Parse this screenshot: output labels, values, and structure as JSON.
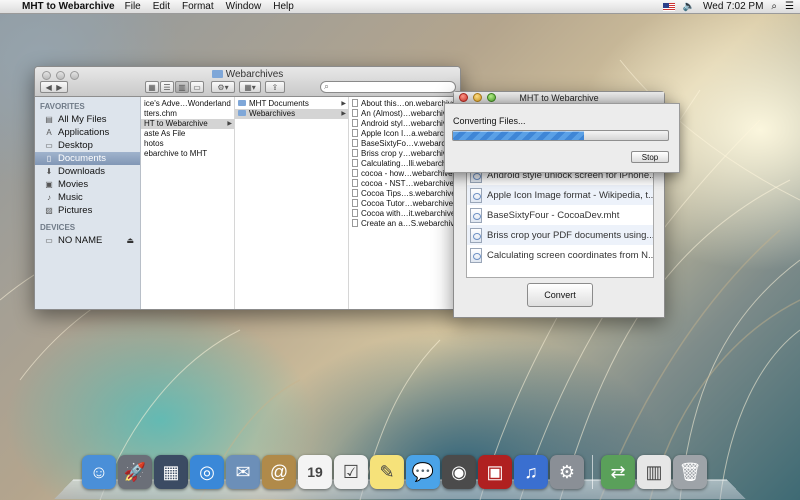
{
  "menubar": {
    "app_name": "MHT to Webarchive",
    "menus": [
      "File",
      "Edit",
      "Format",
      "Window",
      "Help"
    ],
    "clock": "Wed 7:02 PM"
  },
  "finder": {
    "title": "Webarchives",
    "search_placeholder": "",
    "sidebar": {
      "favorites_header": "FAVORITES",
      "favorites": [
        {
          "label": "All My Files",
          "icon": "all-files-icon"
        },
        {
          "label": "Applications",
          "icon": "applications-icon"
        },
        {
          "label": "Desktop",
          "icon": "desktop-icon"
        },
        {
          "label": "Documents",
          "icon": "documents-icon",
          "selected": true
        },
        {
          "label": "Downloads",
          "icon": "downloads-icon"
        },
        {
          "label": "Movies",
          "icon": "movies-icon"
        },
        {
          "label": "Music",
          "icon": "music-icon"
        },
        {
          "label": "Pictures",
          "icon": "pictures-icon"
        }
      ],
      "devices_header": "DEVICES",
      "devices": [
        {
          "label": "NO NAME",
          "icon": "disk-icon"
        }
      ]
    },
    "column1": [
      "ice's Adve…Wonderland",
      "tters.chm",
      "HT to Webarchive",
      "aste As File",
      "hotos",
      "ebarchive to MHT"
    ],
    "column1_selected_index": 2,
    "column2": [
      "MHT Documents",
      "Webarchives"
    ],
    "column2_selected_index": 1,
    "column3": [
      "About this…on.webarchive",
      "An (Almost)…webarchive",
      "Android styl…webarchive",
      "Apple Icon I…a.webarchive",
      "BaseSixtyFo…v.webarchive",
      "Briss  crop y…webarchive",
      "Calculating…lli.webarchive",
      "cocoa - how…webarchive",
      "cocoa - NST…webarchive",
      "Cocoa Tips…s.webarchive",
      "Cocoa Tutor…webarchive",
      "Cocoa with…it.webarchive",
      "Create an a…S.webarchive"
    ]
  },
  "mht_window": {
    "title": "MHT to Webarchive",
    "files": [
      "Android style unlock screen for iPhone...",
      "Apple Icon Image format - Wikipedia, t...",
      "BaseSixtyFour - CocoaDev.mht",
      "Briss  crop your PDF documents using...",
      "Calculating screen coordinates from N..."
    ],
    "convert_label": "Convert"
  },
  "sheet": {
    "label": "Converting Files...",
    "progress": 0.61,
    "stop_label": "Stop"
  },
  "dock": {
    "items": [
      {
        "name": "finder",
        "color": "#4a8fd8",
        "glyph": "☺"
      },
      {
        "name": "launchpad",
        "color": "#6b6f78",
        "glyph": "🚀"
      },
      {
        "name": "mission-control",
        "color": "#3b4b63",
        "glyph": "▦"
      },
      {
        "name": "safari",
        "color": "#3a88d8",
        "glyph": "◎"
      },
      {
        "name": "mail",
        "color": "#6c8fb8",
        "glyph": "✉"
      },
      {
        "name": "contacts",
        "color": "#b08a4a",
        "glyph": "@"
      },
      {
        "name": "calendar",
        "color": "#f4f4f4",
        "glyph": "19"
      },
      {
        "name": "reminders",
        "color": "#f0f0f0",
        "glyph": "☑"
      },
      {
        "name": "notes",
        "color": "#f6e27a",
        "glyph": "✎"
      },
      {
        "name": "messages",
        "color": "#4aa3e8",
        "glyph": "💬"
      },
      {
        "name": "facetime",
        "color": "#4b4b4b",
        "glyph": "◉"
      },
      {
        "name": "photo-booth",
        "color": "#b02020",
        "glyph": "▣"
      },
      {
        "name": "itunes",
        "color": "#3a6fd0",
        "glyph": "♫"
      },
      {
        "name": "system-preferences",
        "color": "#8a8f96",
        "glyph": "⚙"
      },
      {
        "name": "mht-to-webarchive",
        "color": "#5aa05a",
        "glyph": "⇄"
      },
      {
        "name": "archive",
        "color": "#e6e6e6",
        "glyph": "▥"
      },
      {
        "name": "trash",
        "color": "#9ea3a8",
        "glyph": "🗑"
      }
    ]
  }
}
